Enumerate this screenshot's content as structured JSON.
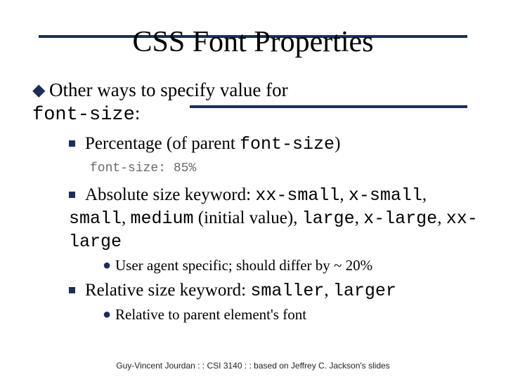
{
  "title": "CSS Font Properties",
  "heading": {
    "prefix": "Other ways to specify value for ",
    "code": "font-size",
    "suffix": ":"
  },
  "items": [
    {
      "parts": [
        {
          "t": "Percentage (of parent "
        },
        {
          "t": "font-size",
          "mono": true
        },
        {
          "t": ")"
        }
      ],
      "code_example": "font-size: 85%"
    },
    {
      "parts": [
        {
          "t": "Absolute size keyword: "
        },
        {
          "t": "xx-small",
          "mono": true
        },
        {
          "t": ", "
        },
        {
          "t": "x-small",
          "mono": true
        },
        {
          "t": ", "
        },
        {
          "t": "small",
          "mono": true
        },
        {
          "t": ", "
        },
        {
          "t": "medium",
          "mono": true
        },
        {
          "t": " (initial value), "
        },
        {
          "t": "large",
          "mono": true
        },
        {
          "t": ", "
        },
        {
          "t": "x-large",
          "mono": true
        },
        {
          "t": ", "
        },
        {
          "t": "xx-large",
          "mono": true
        }
      ],
      "sub": [
        {
          "parts": [
            {
              "t": "User agent specific; should differ by ~ 20%"
            }
          ]
        }
      ]
    },
    {
      "parts": [
        {
          "t": "Relative size keyword: "
        },
        {
          "t": "smaller",
          "mono": true
        },
        {
          "t": ", "
        },
        {
          "t": "larger",
          "mono": true
        }
      ],
      "sub": [
        {
          "parts": [
            {
              "t": "Relative to parent element's font"
            }
          ]
        }
      ]
    }
  ],
  "footer": "Guy-Vincent Jourdan : : CSI 3140 : : based on Jeffrey C. Jackson's slides"
}
